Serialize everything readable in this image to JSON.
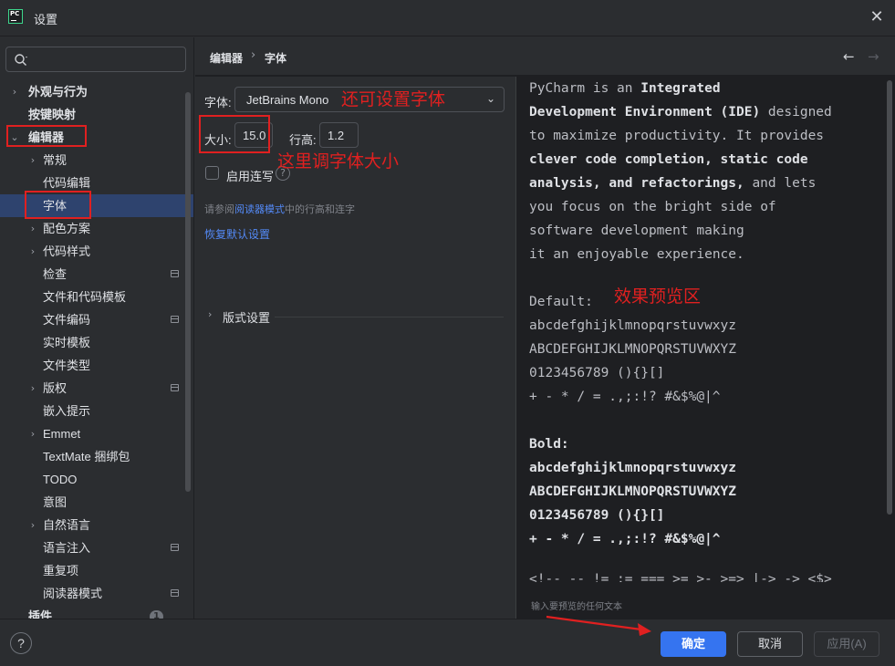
{
  "window": {
    "app_icon_text": "PC",
    "title": "设置",
    "close_glyph": "✕"
  },
  "search": {
    "value": "",
    "placeholder": "",
    "icon": "search-icon"
  },
  "sidebar": {
    "items": [
      {
        "label": "外观与行为",
        "level": 0,
        "expander": "›"
      },
      {
        "label": "按键映射",
        "level": 0,
        "expander": ""
      },
      {
        "label": "编辑器",
        "level": 0,
        "expander": "⌄"
      },
      {
        "label": "常规",
        "level": 1,
        "expander": "›"
      },
      {
        "label": "代码编辑",
        "level": 1,
        "expander": ""
      },
      {
        "label": "字体",
        "level": 1,
        "expander": "",
        "selected": true
      },
      {
        "label": "配色方案",
        "level": 1,
        "expander": "›"
      },
      {
        "label": "代码样式",
        "level": 1,
        "expander": "›"
      },
      {
        "label": "检查",
        "level": 1,
        "expander": "",
        "project_icon": true
      },
      {
        "label": "文件和代码模板",
        "level": 1,
        "expander": ""
      },
      {
        "label": "文件编码",
        "level": 1,
        "expander": "",
        "project_icon": true
      },
      {
        "label": "实时模板",
        "level": 1,
        "expander": ""
      },
      {
        "label": "文件类型",
        "level": 1,
        "expander": ""
      },
      {
        "label": "版权",
        "level": 1,
        "expander": "›",
        "project_icon": true
      },
      {
        "label": "嵌入提示",
        "level": 1,
        "expander": ""
      },
      {
        "label": "Emmet",
        "level": 1,
        "expander": "›"
      },
      {
        "label": "TextMate 捆绑包",
        "level": 1,
        "expander": ""
      },
      {
        "label": "TODO",
        "level": 1,
        "expander": ""
      },
      {
        "label": "意图",
        "level": 1,
        "expander": ""
      },
      {
        "label": "自然语言",
        "level": 1,
        "expander": "›"
      },
      {
        "label": "语言注入",
        "level": 1,
        "expander": "",
        "project_icon": true
      },
      {
        "label": "重复项",
        "level": 1,
        "expander": ""
      },
      {
        "label": "阅读器模式",
        "level": 1,
        "expander": "",
        "project_icon": true
      },
      {
        "label": "插件",
        "level": 0,
        "expander": "",
        "badge": "1"
      }
    ]
  },
  "breadcrumb": {
    "parent": "编辑器",
    "separator": "›",
    "current": "字体",
    "back_glyph": "←",
    "forward_glyph": "→"
  },
  "font_settings": {
    "font_label": "字体:",
    "font_value": "JetBrains Mono",
    "size_label": "大小:",
    "size_value": "15.0",
    "line_height_label": "行高:",
    "line_height_value": "1.2",
    "ligatures_label": "启用连写",
    "ligatures_checked": false,
    "hint_prefix": "请参阅",
    "hint_link": "阅读器模式",
    "hint_suffix": "中的行高和连字",
    "restore_link": "恢复默认设置",
    "layout_section": "版式设置"
  },
  "preview": {
    "lines": [
      "PyCharm is an Integrated",
      "Development Environment (IDE) designed",
      "to maximize productivity. It provides",
      "clever code completion, static code",
      "analysis, and refactorings, and lets",
      "you focus on the bright side of",
      "software development making",
      "it an enjoyable experience.",
      "",
      "Default:",
      "abcdefghijklmnopqrstuvwxyz",
      "ABCDEFGHIJKLMNOPQRSTUVWXYZ",
      "0123456789 (){}[]",
      "+ - * / = .,;:!? #&$%@|^",
      "",
      "Bold:",
      "abcdefghijklmnopqrstuvwxyz",
      "ABCDEFGHIJKLMNOPQRSTUVWXYZ",
      "0123456789 (){}[]",
      "+ - * / = .,;:!? #&$%@|^"
    ],
    "partial_line": "<!-- -- != := === >= >- >=> |-> -> <$>",
    "hint": "输入要预览的任何文本"
  },
  "footer": {
    "help": "?",
    "ok": "确定",
    "cancel": "取消",
    "apply": "应用(A)"
  },
  "annotations": {
    "font_note": "还可设置字体",
    "size_note": "这里调字体大小",
    "preview_note": "效果预览区",
    "color": "#e02020"
  },
  "colors": {
    "accent": "#3574f0",
    "selection": "#2e436e",
    "link": "#548af7"
  }
}
